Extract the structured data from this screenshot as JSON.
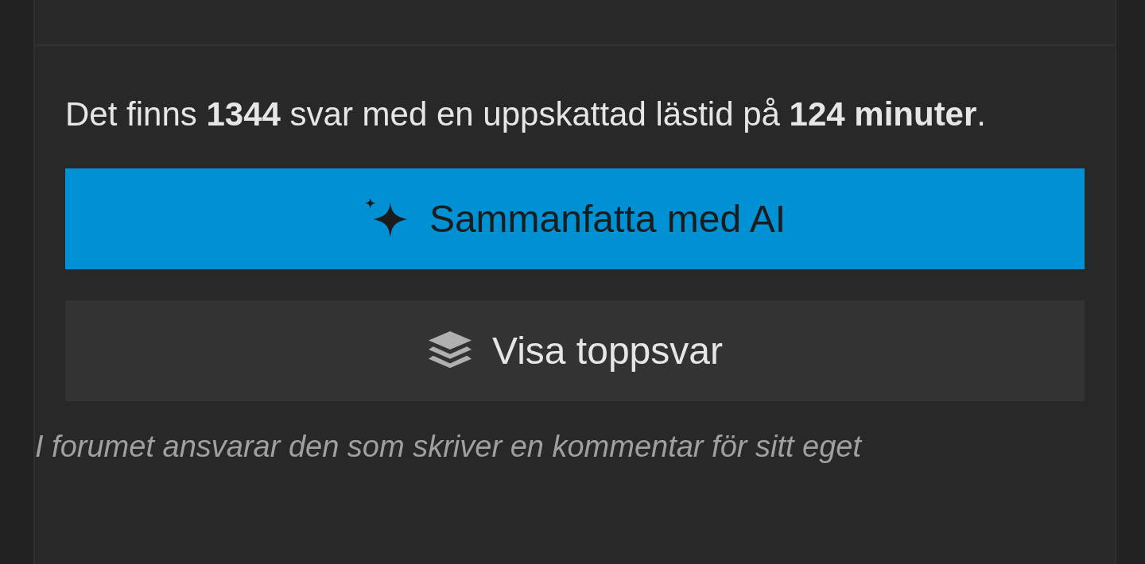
{
  "summary": "Det finns **1344** svar med en uppskattad lästid på **124 minuter**.",
  "buttons": [
    {
      "kind": "primary",
      "label": "Sammanfatta med AI"
    },
    {
      "kind": "secondary",
      "label": "Visa toppsvar"
    }
  ],
  "disclaimer": "I forumet ansvarar den som skriver en kommentar för sitt eget"
}
